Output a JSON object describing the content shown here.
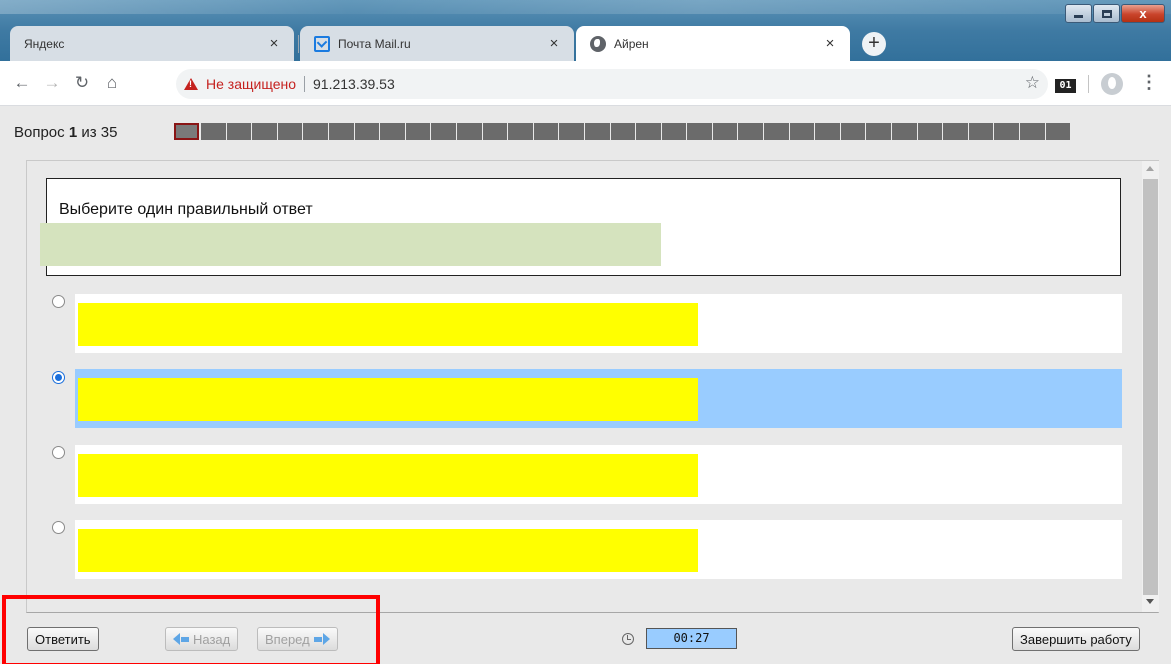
{
  "browser": {
    "tabs": [
      {
        "title": "Яндекс",
        "active": false
      },
      {
        "title": "Почта Mail.ru",
        "active": false
      },
      {
        "title": "Айрен",
        "active": true
      }
    ],
    "tab_close_glyph": "×",
    "new_tab_glyph": "+",
    "security_label": "Не защищено",
    "url": "91.213.39.53",
    "extension_badge": "01",
    "icons": [
      "back-arrow-icon",
      "forward-arrow-icon",
      "reload-icon",
      "home-icon",
      "warning-icon",
      "star-icon",
      "profile-icon",
      "menu-icon"
    ]
  },
  "window_controls": {
    "close_glyph": "x"
  },
  "question_nav": {
    "label_prefix": "Вопрос",
    "current": "1",
    "label_middle": "из",
    "total": "35"
  },
  "question": {
    "prompt": "Выберите один правильный ответ"
  },
  "options": [
    {
      "selected": false
    },
    {
      "selected": true
    },
    {
      "selected": false
    },
    {
      "selected": false
    }
  ],
  "footer": {
    "answer_button": "Ответить",
    "back_button": "Назад",
    "forward_button": "Вперед",
    "timer": "00:27",
    "finish_button": "Завершить работу"
  },
  "colors": {
    "selected_option": "#99ccff",
    "answer_block": "#ffff00",
    "question_block": "#d5e3be",
    "highlight": "#ff0000",
    "current_question_border": "#8a1515"
  }
}
